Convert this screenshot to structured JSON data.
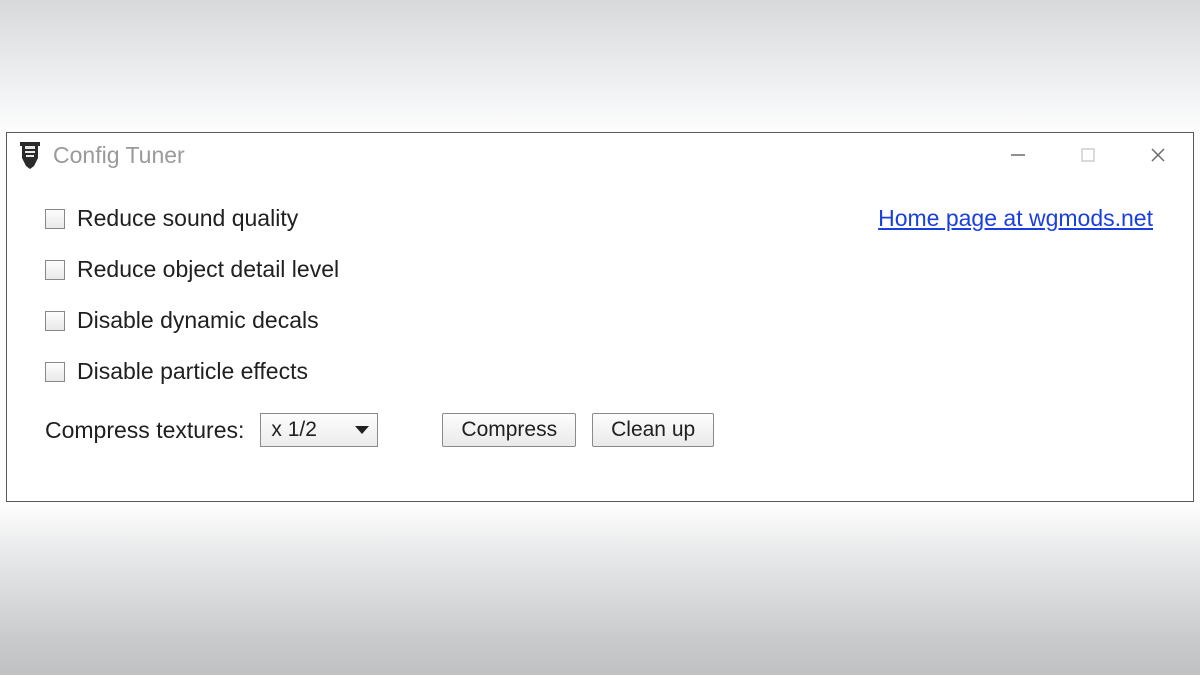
{
  "window": {
    "title": "Config Tuner"
  },
  "link": {
    "home_page": "Home page at wgmods.net"
  },
  "checkboxes": [
    {
      "label": "Reduce sound quality",
      "checked": false
    },
    {
      "label": "Reduce object detail level",
      "checked": false
    },
    {
      "label": "Disable dynamic decals",
      "checked": false
    },
    {
      "label": "Disable particle effects",
      "checked": false
    }
  ],
  "compress": {
    "label": "Compress textures:",
    "selected": "x 1/2",
    "options": [
      "x 1/2"
    ],
    "compress_button": "Compress",
    "cleanup_button": "Clean up"
  }
}
